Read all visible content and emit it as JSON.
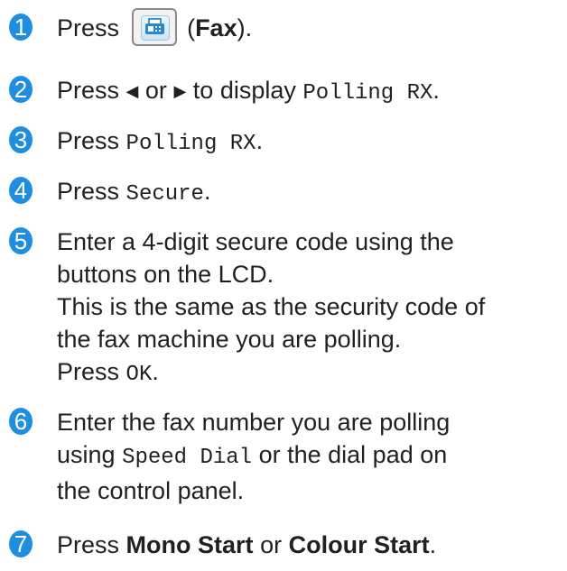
{
  "steps": [
    {
      "num": "1",
      "press": "Press",
      "paren_open": "(",
      "fax": "Fax",
      "paren_close": ")."
    },
    {
      "num": "2",
      "press": "Press",
      "left_arrow": "◀",
      "or": "or",
      "right_arrow": "▶",
      "to_display": "to display",
      "polling_rx": "Polling RX",
      "period": "."
    },
    {
      "num": "3",
      "press": "Press",
      "polling_rx": "Polling RX",
      "period": "."
    },
    {
      "num": "4",
      "press": "Press",
      "secure": "Secure",
      "period": "."
    },
    {
      "num": "5",
      "line1": "Enter a 4-digit secure code using the",
      "line2": "buttons on the LCD.",
      "line3": "This is the same as the security code of",
      "line4": "the fax machine you are polling.",
      "press": "Press",
      "ok": "OK",
      "period": "."
    },
    {
      "num": "6",
      "line1": "Enter the fax number you are polling",
      "using": "using",
      "speed_dial": "Speed Dial",
      "or_dial": "or the dial pad on",
      "line3": "the control panel."
    },
    {
      "num": "7",
      "press": "Press",
      "mono": "Mono Start",
      "or": "or",
      "colour": "Colour Start",
      "period": "."
    }
  ],
  "colors": {
    "number_circle": "#1f8de0",
    "text": "#231f20"
  },
  "icons": {
    "fax_button": "fax-icon"
  }
}
